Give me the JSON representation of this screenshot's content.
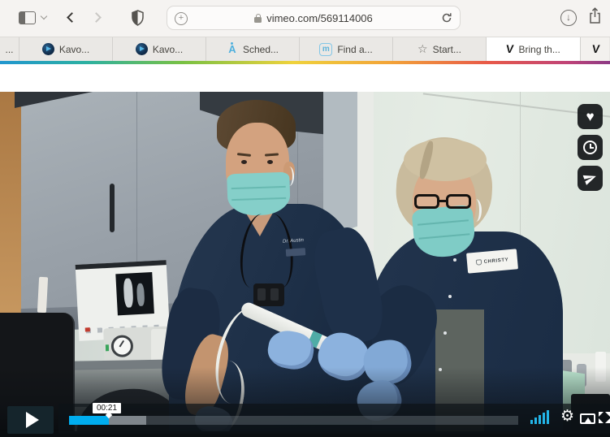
{
  "browser": {
    "url": "vimeo.com/569114006",
    "icons": {
      "plus": "+",
      "down_arrow": "↓",
      "star": "☆",
      "vimeo_letter": "V",
      "sched_letter": "A",
      "find_letter": "m",
      "heart": "♥",
      "gear": "⚙"
    }
  },
  "tabs": [
    {
      "label": "..."
    },
    {
      "label": "Kavo..."
    },
    {
      "label": "Kavo..."
    },
    {
      "label": "Sched..."
    },
    {
      "label": "Find a..."
    },
    {
      "label": "Start..."
    },
    {
      "label": "Bring th..."
    },
    {
      "label": ""
    }
  ],
  "player": {
    "time_tooltip": "00:21"
  },
  "scene": {
    "doctor_embroidery": "Dr. Austin",
    "assistant_badge": "CHRISTY"
  },
  "colors": {
    "vimeo_blue": "#00adef",
    "mask_teal": "#7fccc6",
    "scrub_navy": "#1d2f47",
    "rainbow": [
      "#2196cf",
      "#2cb0a2",
      "#79c143",
      "#efd23c",
      "#f2a338",
      "#e85948",
      "#c04377"
    ]
  }
}
